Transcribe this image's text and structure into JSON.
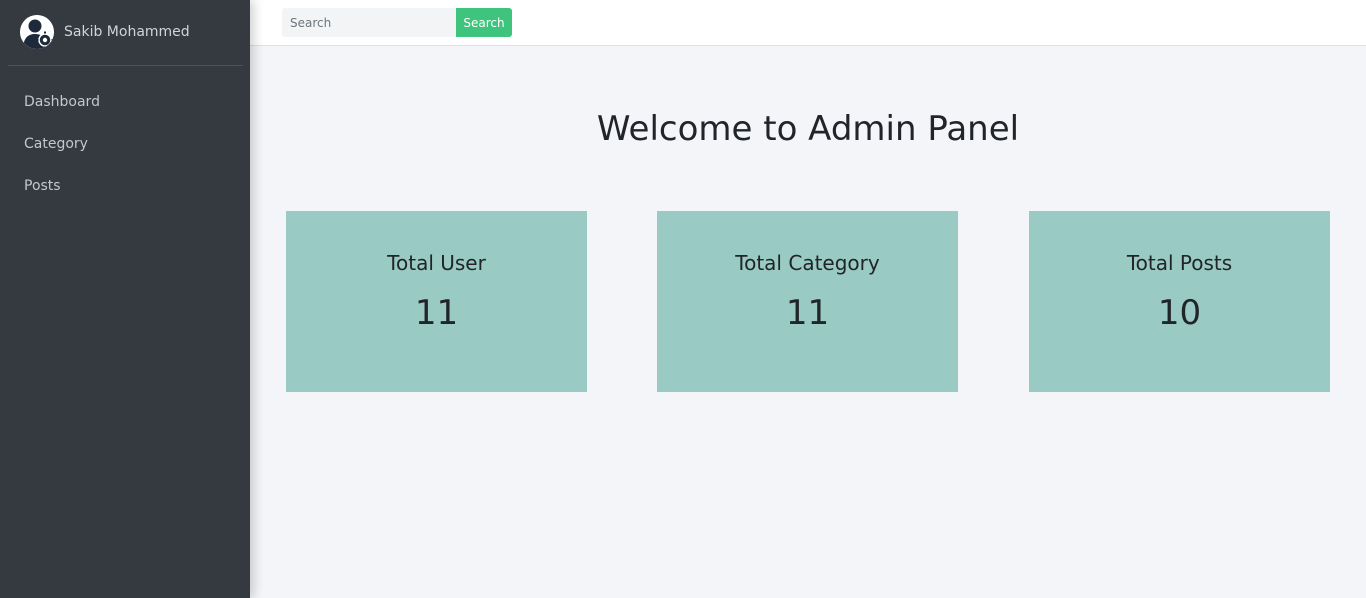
{
  "sidebar": {
    "user": {
      "name": "Sakib Mohammed",
      "avatar_icon": "user-gear-avatar-icon"
    },
    "items": [
      {
        "label": "Dashboard"
      },
      {
        "label": "Category"
      },
      {
        "label": "Posts"
      }
    ]
  },
  "topbar": {
    "search": {
      "placeholder": "Search",
      "value": "",
      "button_label": "Search"
    }
  },
  "main": {
    "title": "Welcome to Admin Panel",
    "cards": [
      {
        "label": "Total User",
        "value": "11"
      },
      {
        "label": "Total Category",
        "value": "11"
      },
      {
        "label": "Total Posts",
        "value": "10"
      }
    ]
  },
  "colors": {
    "sidebar_bg": "#343a40",
    "sidebar_text": "#c2c7d0",
    "search_button": "#3ec47c",
    "card_bg": "#99cac3",
    "page_bg": "#f4f5f9"
  }
}
